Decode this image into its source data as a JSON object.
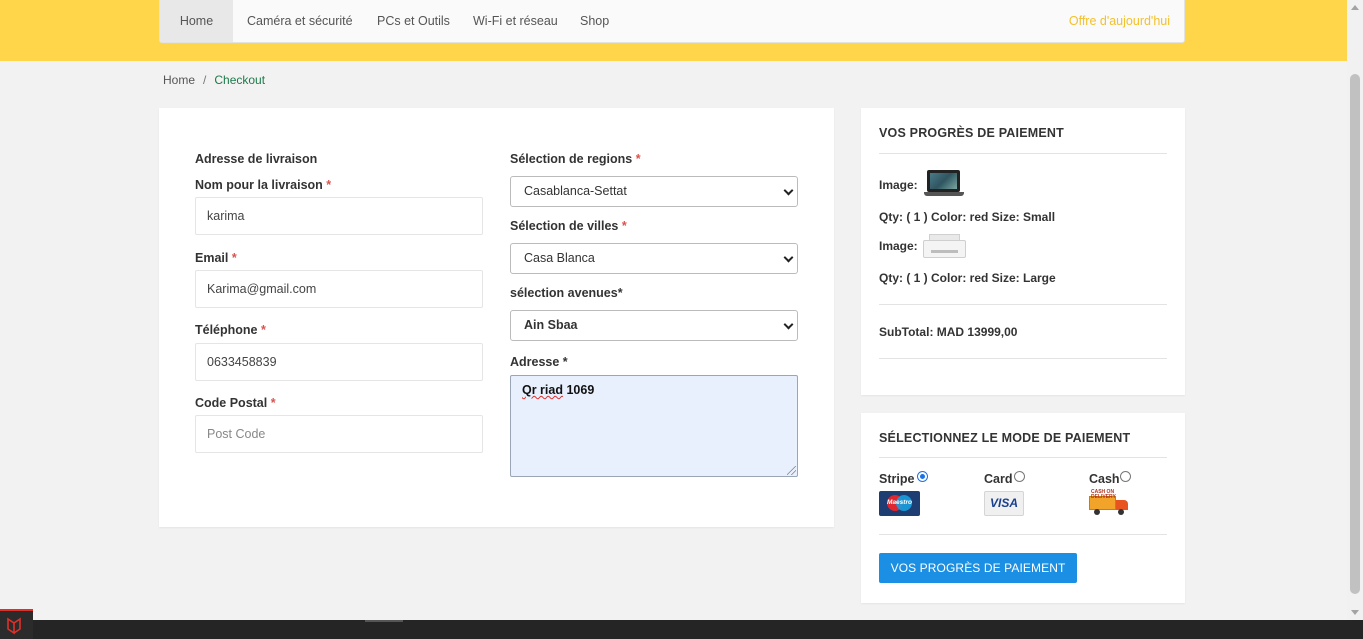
{
  "nav": {
    "items": [
      "Home",
      "Caméra et sécurité",
      "PCs et Outils",
      "Wi-Fi et réseau",
      "Shop"
    ],
    "offer": "Offre d'aujourd'hui"
  },
  "breadcrumb": {
    "home": "Home",
    "separator": "/",
    "current": "Checkout"
  },
  "form": {
    "section_title": "Adresse de livraison",
    "name_label": "Nom pour la livraison",
    "name_value": "karima",
    "email_label": "Email",
    "email_value": "Karima@gmail.com",
    "phone_label": "Téléphone",
    "phone_value": "0633458839",
    "postal_label": "Code Postal",
    "postal_placeholder": "Post Code",
    "region_label": "Sélection de regions",
    "region_value": "Casablanca-Settat",
    "city_label": "Sélection de villes",
    "city_value": "Casa Blanca",
    "avenue_label": "sélection avenues*",
    "avenue_value": "Ain Sbaa",
    "address_label": "Adresse *",
    "address_value_prefix": "Qr riad",
    "address_value_suffix": " 1069",
    "required_mark": "*"
  },
  "progress": {
    "title": "VOS PROGRÈS DE PAIEMENT",
    "image_label": "Image:",
    "items": [
      {
        "qty_line": "Qty: ( 1 ) Color: red Size: Small",
        "icon": "laptop-icon"
      },
      {
        "qty_line": "Qty: ( 1 ) Color: red Size: Large",
        "icon": "printer-icon"
      }
    ],
    "subtotal": "SubTotal: MAD 13999,00"
  },
  "payment": {
    "title": "SÉLECTIONNEZ LE MODE DE PAIEMENT",
    "options": [
      {
        "label": "Stripe",
        "selected": true,
        "logo": "maestro-logo"
      },
      {
        "label": "Card",
        "selected": false,
        "logo": "visa-logo"
      },
      {
        "label": "Cash",
        "selected": false,
        "logo": "delivery-truck-logo"
      }
    ],
    "maestro_text": "Maestro",
    "visa_text": "VISA",
    "cash_tag": "CASH ON DELIVERY",
    "button": "VOS PROGRÈS DE PAIEMENT"
  },
  "colors": {
    "topbar": "#ffd54a",
    "accent_green": "#1d7a4a",
    "button_blue": "#1a8fe3",
    "required_red": "#d9534f"
  }
}
